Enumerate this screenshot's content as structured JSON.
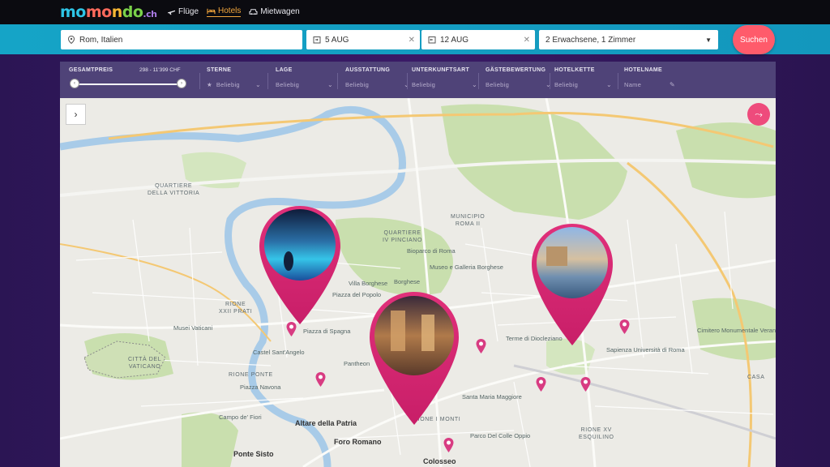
{
  "brand": {
    "logo_parts": [
      "mo",
      "mo",
      "n",
      "do",
      "do"
    ],
    "logo_suffix": ".ch"
  },
  "nav": [
    {
      "label": "Flüge",
      "icon": "plane-icon",
      "active": false
    },
    {
      "label": "Hotels",
      "icon": "bed-icon",
      "active": true
    },
    {
      "label": "Mietwagen",
      "icon": "car-icon",
      "active": false
    }
  ],
  "search": {
    "destination": "Rom, Italien",
    "checkin": "5 AUG",
    "checkout": "12 AUG",
    "guests": "2 Erwachsene, 1 Zimmer",
    "button": "Suchen"
  },
  "filters": {
    "price": {
      "label": "Gesamtpreis",
      "range": "298 - 11'399 CHF"
    },
    "items": [
      {
        "label": "Sterne",
        "value": "Beliebig"
      },
      {
        "label": "Lage",
        "value": "Beliebig"
      },
      {
        "label": "Ausstattung",
        "value": "Beliebig"
      },
      {
        "label": "Unterkunftsart",
        "value": "Beliebig"
      },
      {
        "label": "Gästebewertung",
        "value": "Beliebig"
      },
      {
        "label": "Hotelkette",
        "value": "Beliebig"
      },
      {
        "label": "Hotelname",
        "value": "Name"
      }
    ]
  },
  "map": {
    "areas": [
      {
        "text": "Quartiere\nDella Vittoria"
      },
      {
        "text": "Municipio\nRoma II"
      },
      {
        "text": "Quartiere\nIV Pinciano"
      },
      {
        "text": "Rione\nXXII Prati"
      },
      {
        "text": "Città del\nVaticano"
      },
      {
        "text": "Rione Ponte"
      },
      {
        "text": "Rione I Monti"
      },
      {
        "text": "Rione XV\nEsquilino"
      },
      {
        "text": "Casa"
      }
    ],
    "pois": [
      "Piazza del Popolo",
      "Musei Vaticani",
      "Castel Sant'Angelo",
      "Piazza di Spagna",
      "Pantheon",
      "Piazza Navona",
      "Campo de' Fiori",
      "Altare della Patria",
      "Foro Romano",
      "Colosseo",
      "Ponte Sisto",
      "Parco Del Colle Oppio",
      "Santa Maria Maggiore",
      "Terme di Diocleziano",
      "Museo e Galleria Borghese",
      "Sapienza Università di Roma",
      "Cimitero Monumentale Verano",
      "Borghese",
      "Bioparco di Roma",
      "Villa Borghese"
    ]
  }
}
